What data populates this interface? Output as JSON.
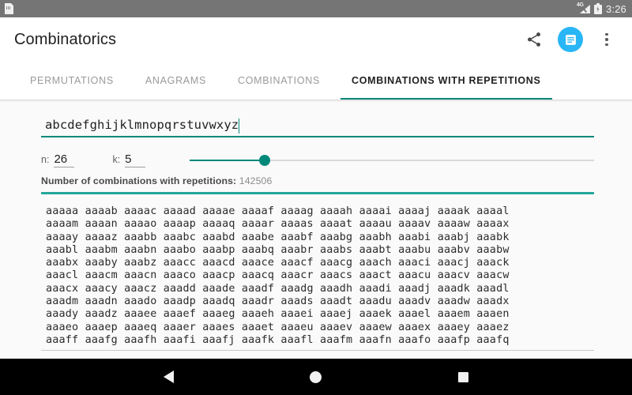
{
  "status_bar": {
    "left_icon": "sd-card-icon",
    "network_label": "4G",
    "signal_icon": "signal-cellular-icon",
    "battery_icon": "battery-charging-icon",
    "time": "3:26"
  },
  "app_bar": {
    "title": "Combinatorics",
    "actions": [
      {
        "name": "share-button",
        "icon": "share-icon"
      },
      {
        "name": "document-button",
        "icon": "document-icon",
        "color": "#29b6f6"
      },
      {
        "name": "overflow-menu-button",
        "icon": "more-vert-icon"
      }
    ]
  },
  "tabs": {
    "accent_color": "#00897b",
    "items": [
      {
        "label": "PERMUTATIONS",
        "active": false
      },
      {
        "label": "ANAGRAMS",
        "active": false
      },
      {
        "label": "COMBINATIONS",
        "active": false
      },
      {
        "label": "COMBINATIONS WITH REPETITIONS",
        "active": true
      }
    ]
  },
  "form": {
    "input_value": "abcdefghijklmnopqrstuvwxyz",
    "input_placeholder": "",
    "n_label": "n:",
    "n_value": "26",
    "k_label": "k:",
    "k_value": "5",
    "slider": {
      "value": 5,
      "min": 1,
      "max": 26,
      "percent": 18.6
    }
  },
  "result": {
    "label": "Number of combinations with repetitions:",
    "value": "142506",
    "divider_color": "#26a69a"
  },
  "combinations": {
    "rows": [
      "aaaaa aaaab aaaac aaaad aaaae aaaaf aaaag aaaah aaaai aaaaj aaaak aaaal",
      "aaaam aaaan aaaao aaaap aaaaq aaaar aaaas aaaat aaaau aaaav aaaaw aaaax",
      "aaaay aaaaz aaabb aaabc aaabd aaabe aaabf aaabg aaabh aaabi aaabj aaabk",
      "aaabl aaabm aaabn aaabo aaabp aaabq aaabr aaabs aaabt aaabu aaabv aaabw",
      "aaabx aaaby aaabz aaacc aaacd aaace aaacf aaacg aaach aaaci aaacj aaack",
      "aaacl aaacm aaacn aaaco aaacp aaacq aaacr aaacs aaact aaacu aaacv aaacw",
      "aaacx aaacy aaacz aaadd aaade aaadf aaadg aaadh aaadi aaadj aaadk aaadl",
      "aaadm aaadn aaado aaadp aaadq aaadr aaads aaadt aaadu aaadv aaadw aaadx",
      "aaady aaadz aaaee aaaef aaaeg aaaeh aaaei aaaej aaaek aaael aaaem aaaen",
      "aaaeo aaaep aaaeq aaaer aaaes aaaet aaaeu aaaev aaaew aaaex aaaey aaaez",
      "aaaff aaafg aaafh aaafi aaafj aaafk aaafl aaafm aaafn aaafo aaafp aaafq"
    ]
  },
  "nav_bar": {
    "back": "back-icon",
    "home": "home-icon",
    "recents": "recents-icon"
  }
}
